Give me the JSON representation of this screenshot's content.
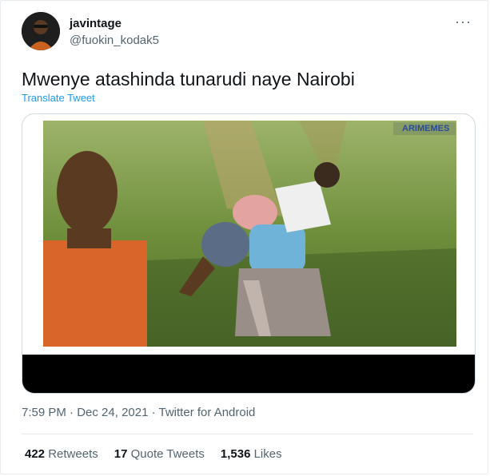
{
  "user": {
    "name": "javintage",
    "handle": "@fuokin_kodak5",
    "avatar_icon": "avatar-photo"
  },
  "tweet": {
    "text": "Mwenye atashinda tunarudi naye Nairobi",
    "translate_label": "Translate Tweet",
    "more_icon": "more-icon"
  },
  "media": {
    "watermark": "ARIMEMES"
  },
  "meta": {
    "time": "7:59 PM",
    "separator1": " · ",
    "date": "Dec 24, 2021",
    "separator2": " · ",
    "source": "Twitter for Android"
  },
  "stats": {
    "retweets_count": "422",
    "retweets_label": "Retweets",
    "quote_count": "17",
    "quote_label": "Quote Tweets",
    "likes_count": "1,536",
    "likes_label": "Likes"
  },
  "colors": {
    "link": "#1d9bf0",
    "secondary_text": "#536471",
    "primary_text": "#0f1419"
  }
}
